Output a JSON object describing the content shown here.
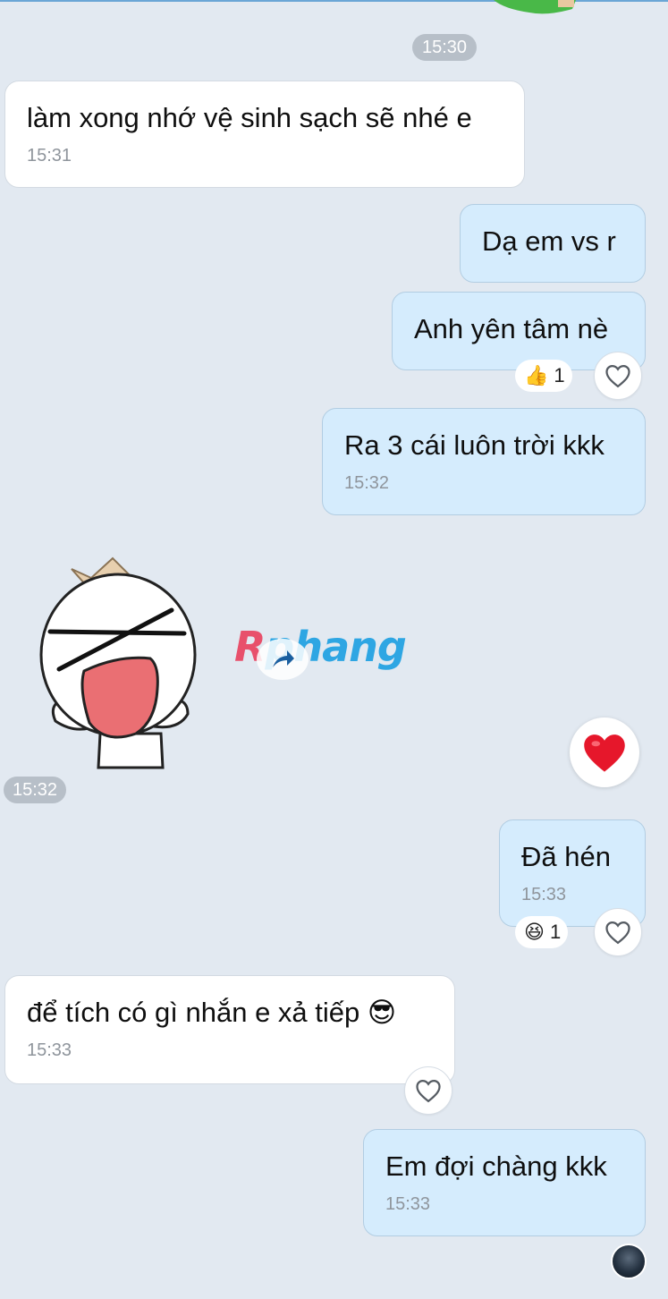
{
  "top_time": "15:30",
  "messages": [
    {
      "text": "làm xong nhớ vệ sinh sạch sẽ nhé e",
      "time": "15:31"
    },
    {
      "text": "Dạ em vs r"
    },
    {
      "text": "Anh yên tâm nè",
      "reaction_emoji": "👍",
      "reaction_count": "1"
    },
    {
      "text": "Ra 3 cái luôn trời kkk",
      "time": "15:32"
    },
    {
      "sticker_time": "15:32",
      "reaction_emoji": "❤️"
    },
    {
      "text": "Đã hén",
      "time": "15:33",
      "reaction_emoji": "😆",
      "reaction_count": "1"
    },
    {
      "text": "để tích có gì nhắn e xả tiếp",
      "emoji": "😎",
      "time": "15:33"
    },
    {
      "text": "Em đợi chàng kkk",
      "time": "15:33"
    }
  ],
  "watermark": {
    "first": "R",
    "rest": "phang"
  },
  "icons": {
    "heart_outline": "heart-outline-icon",
    "heart_filled": "heart-filled-icon",
    "sticker": "laughing-sticker",
    "avatar": "sender-avatar"
  },
  "colors": {
    "background": "#e2e9f1",
    "incoming_bubble": "#ffffff",
    "outgoing_bubble": "#d5ecfd",
    "time_chip": "#b7bfc8",
    "heart": "#e6172b"
  }
}
